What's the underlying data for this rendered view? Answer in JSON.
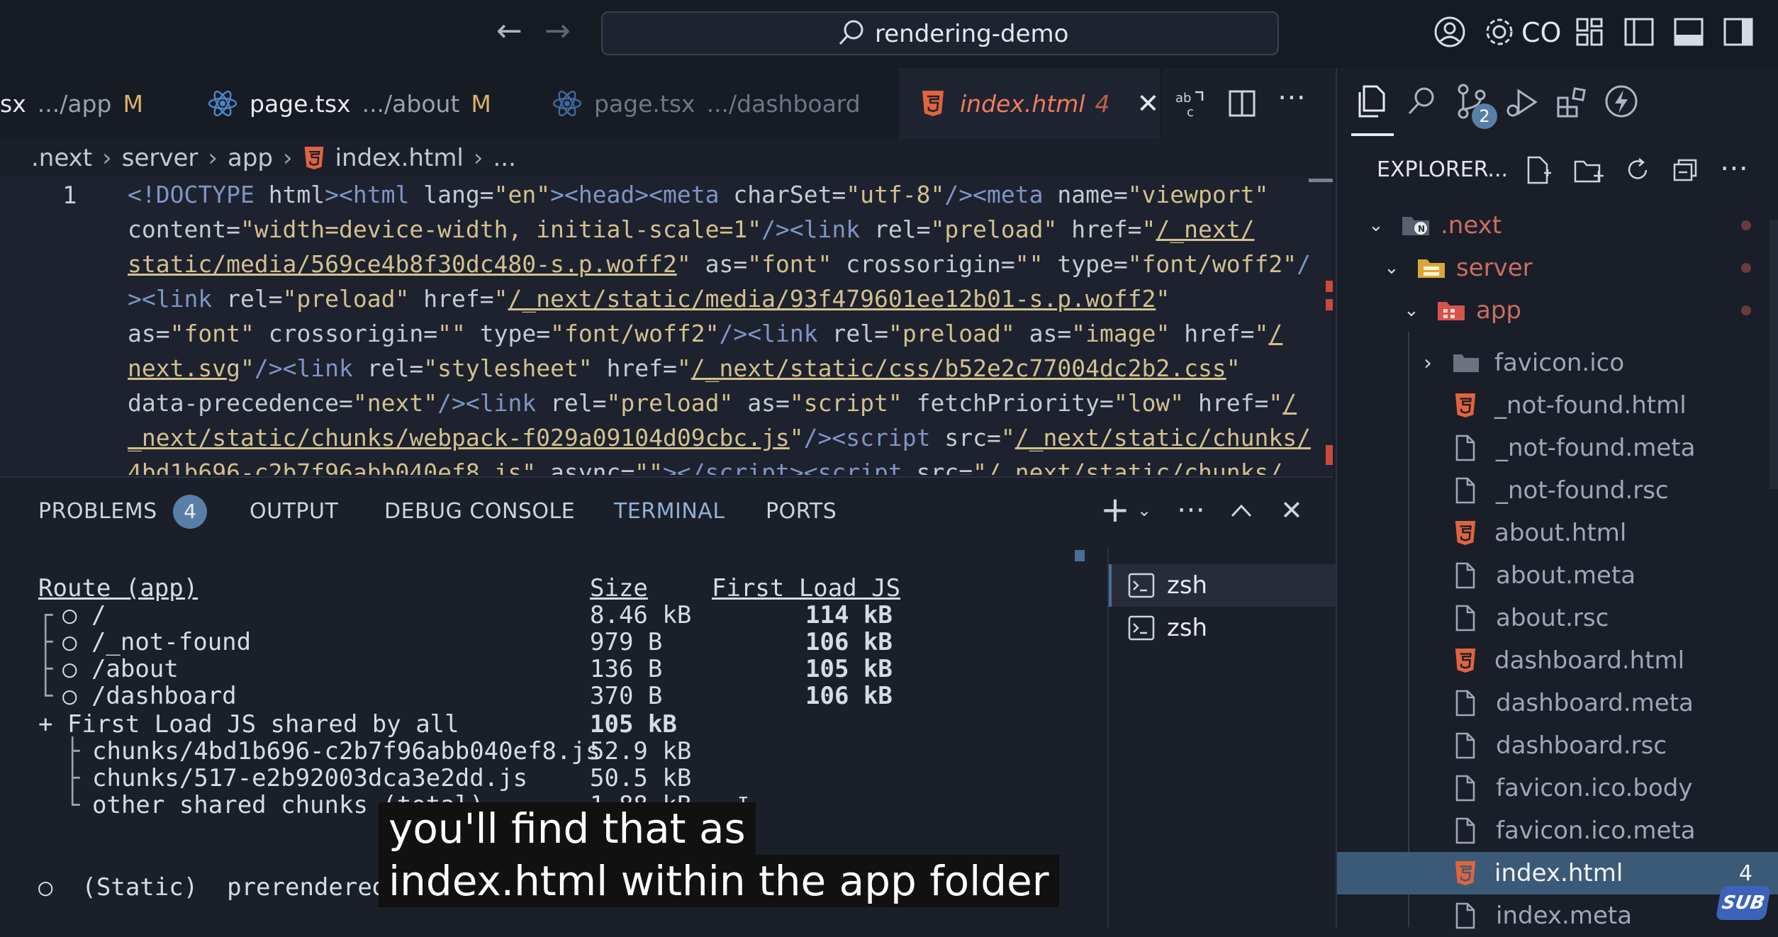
{
  "titlebar": {
    "search_text": "rendering-demo",
    "account_label": "CO",
    "icons": [
      "arrow-left-icon",
      "arrow-right-icon",
      "search-icon",
      "account-icon",
      "gear-icon",
      "layout-icon",
      "toggle-sidebar-icon",
      "toggle-panel-icon",
      "toggle-secondary-sidebar-icon"
    ]
  },
  "tabs": [
    {
      "name": "sx",
      "path": ".../app",
      "mod": "M"
    },
    {
      "name": "page.tsx",
      "path": ".../about",
      "mod": "M"
    },
    {
      "name": "page.tsx",
      "path": ".../dashboard",
      "mod": ""
    },
    {
      "name": "index.html",
      "path": "",
      "mod": "4"
    }
  ],
  "breadcrumb": [
    ".next",
    "server",
    "app",
    "index.html",
    "..."
  ],
  "editor": {
    "line_number": "1"
  },
  "panel": {
    "tabs": [
      "PROBLEMS",
      "OUTPUT",
      "DEBUG CONSOLE",
      "TERMINAL",
      "PORTS"
    ],
    "problems_count": "4"
  },
  "terminal": {
    "header_route": "Route (app)",
    "header_size": "Size",
    "header_first_load": "First Load JS",
    "rows": [
      {
        "tree": "┌",
        "route": "○ /",
        "size": "8.46 kB",
        "first": "114 kB"
      },
      {
        "tree": "├",
        "route": "○ /_not-found",
        "size": "979 B",
        "first": "106 kB"
      },
      {
        "tree": "├",
        "route": "○ /about",
        "size": "136 B",
        "first": "105 kB"
      },
      {
        "tree": "└",
        "route": "○ /dashboard",
        "size": "370 B",
        "first": "106 kB"
      }
    ],
    "shared_label": "+ First Load JS shared by all",
    "shared_size": "105 kB",
    "chunks": [
      {
        "tree": "├",
        "name": "chunks/4bd1b696-c2b7f96abb040ef8.js",
        "size": "52.9 kB"
      },
      {
        "tree": "├",
        "name": "chunks/517-e2b92003dca3e2dd.js",
        "size": "50.5 kB"
      },
      {
        "tree": "└",
        "name": "other shared chunks (total)",
        "size": "1.88 kB"
      }
    ],
    "legend": "○  (Static)  prerendered as static content"
  },
  "shells": [
    "zsh",
    "zsh"
  ],
  "explorer": {
    "title": "EXPLORER...",
    "folders": [
      ".next",
      "server",
      "app"
    ],
    "files": [
      {
        "name": "favicon.ico",
        "kind": "folder"
      },
      {
        "name": "_not-found.html",
        "kind": "html"
      },
      {
        "name": "_not-found.meta",
        "kind": "file"
      },
      {
        "name": "_not-found.rsc",
        "kind": "file"
      },
      {
        "name": "about.html",
        "kind": "html"
      },
      {
        "name": "about.meta",
        "kind": "file"
      },
      {
        "name": "about.rsc",
        "kind": "file"
      },
      {
        "name": "dashboard.html",
        "kind": "html"
      },
      {
        "name": "dashboard.meta",
        "kind": "file"
      },
      {
        "name": "dashboard.rsc",
        "kind": "file"
      },
      {
        "name": "favicon.ico.body",
        "kind": "file"
      },
      {
        "name": "favicon.ico.meta",
        "kind": "file"
      },
      {
        "name": "index.html",
        "kind": "html",
        "badge": "4"
      },
      {
        "name": "index.meta",
        "kind": "file"
      }
    ]
  },
  "scm_badge": "2",
  "caption": [
    "you'll find that as",
    "index.html within the app folder"
  ],
  "watermark": "SUB",
  "colors": {
    "html_icon": "#e0643f",
    "accent": "#5a7fa6",
    "selection": "#3b5a78"
  }
}
